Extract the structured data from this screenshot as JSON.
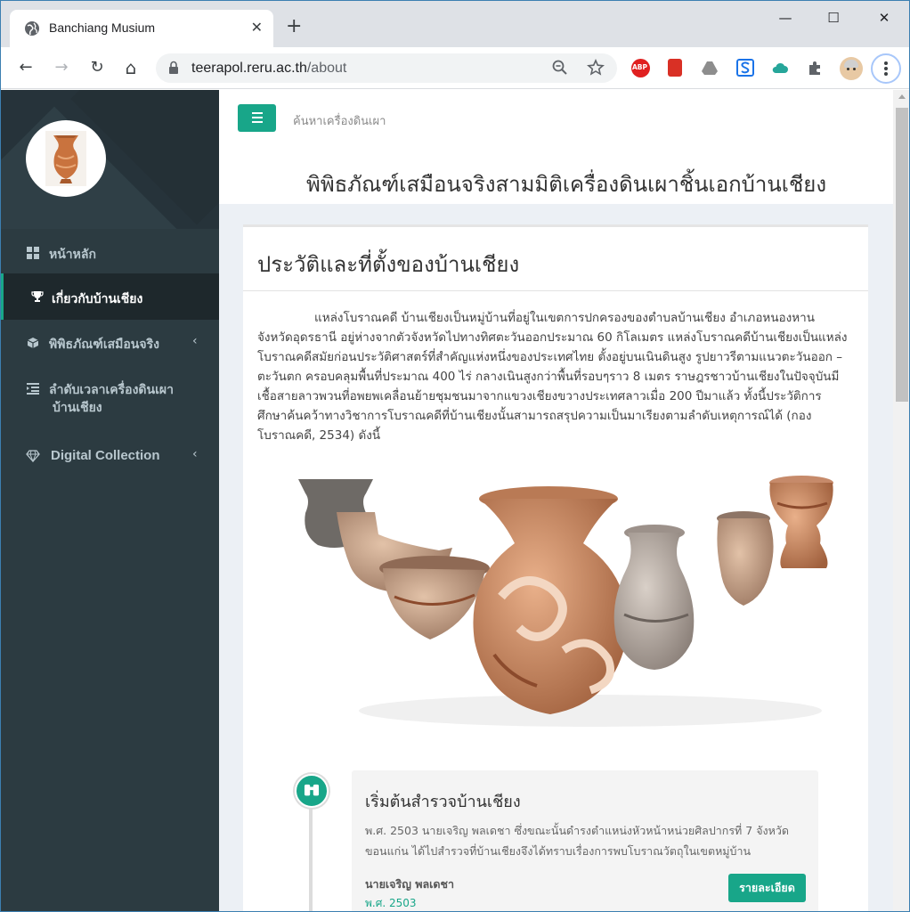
{
  "browser": {
    "tab_title": "Banchiang Musium",
    "tab_close": "✕",
    "new_tab": "+",
    "url_host": "teerapol.reru.ac.th",
    "url_path": "/about",
    "window_controls": {
      "minimize": "—",
      "maximize": "☐",
      "close": "✕"
    },
    "nav": {
      "back": "←",
      "forward": "→",
      "reload": "↻",
      "home": "⌂"
    },
    "extensions": [
      "abp-icon",
      "bookmark-icon",
      "drive-icon",
      "s-icon",
      "cloud-icon",
      "puzzle-icon",
      "profile-avatar",
      "menu-icon"
    ],
    "abp_label": "ABP"
  },
  "sidebar": {
    "items": [
      {
        "label": "หน้าหลัก",
        "icon": "dashboard-icon",
        "active": false
      },
      {
        "label": "เกี่ยวกับบ้านเชียง",
        "icon": "trophy-icon",
        "active": true
      },
      {
        "label": "พิพิธภัณฑ์เสมือนจริง",
        "icon": "cube-icon",
        "active": false,
        "caret": "‹"
      },
      {
        "label": "ลำดับเวลาเครื่องดินเผา",
        "label2": "บ้านเชียง",
        "icon": "list-icon",
        "active": false
      },
      {
        "label": "Digital Collection",
        "icon": "diamond-icon",
        "active": false,
        "caret": "‹"
      }
    ]
  },
  "header": {
    "search_link": "ค้นหาเครื่องดินเผา",
    "site_title": "พิพิธภัณฑ์เสมือนจริงสามมิติเครื่องดินเผาชิ้นเอกบ้านเชียง"
  },
  "article": {
    "title": "ประวัติและที่ตั้งของบ้านเชียง",
    "body": "แหล่งโบราณคดี บ้านเชียงเป็นหมู่บ้านที่อยู่ในเขตการปกครองของตำบลบ้านเชียง อำเภอหนองหาน จังหวัดอุดรธานี อยู่ห่างจากตัวจังหวัดไปทางทิศตะวันออกประมาณ 60 กิโลเมตร แหล่งโบราณคดีบ้านเชียงเป็นแหล่งโบราณคดีสมัยก่อนประวัติศาสตร์ที่สำคัญแห่งหนึ่งของประเทศไทย ตั้งอยู่บนเนินดินสูง รูปยาวรีตามแนวตะวันออก – ตะวันตก ครอบคลุมพื้นที่ประมาณ 400 ไร่ กลางเนินสูงกว่าพื้นที่รอบๆราว 8 เมตร ราษฎรชาวบ้านเชียงในปัจจุบันมีเชื้อสายลาวพวนที่อพยพเคลื่อนย้ายชุมชนมาจากแขวงเชียงขวางประเทศลาวเมื่อ 200 ปีมาแล้ว ทั้งนี้ประวัติการศึกษาค้นคว้าทางวิชาการโบราณคดีที่บ้านเชียงนั้นสามารถสรุปความเป็นมาเรียงตามลำดับเหตุการณ์ได้ (กองโบราณคดี, 2534) ดังนี้"
  },
  "timeline": {
    "icon": "binoculars-icon",
    "title": "เริ่มต้นสำรวจบ้านเชียง",
    "body": "พ.ศ. 2503 นายเจริญ พลเดชา ซึ่งขณะนั้นดำรงตำแหน่งหัวหน้าหน่วยศิลปากรที่ 7 จังหวัดขอนแก่น ได้ไปสำรวจที่บ้านเชียงจึงได้ทราบเรื่องการพบโบราณวัตถุในเขตหมู่บ้าน",
    "person": "นายเจริญ พลเดชา",
    "date": "พ.ศ. 2503",
    "button": "รายละเอียด"
  },
  "colors": {
    "accent": "#18a689",
    "sidebar_bg": "#2c3b41",
    "sidebar_active_bg": "#1e282c",
    "content_bg": "#ecf0f5"
  }
}
